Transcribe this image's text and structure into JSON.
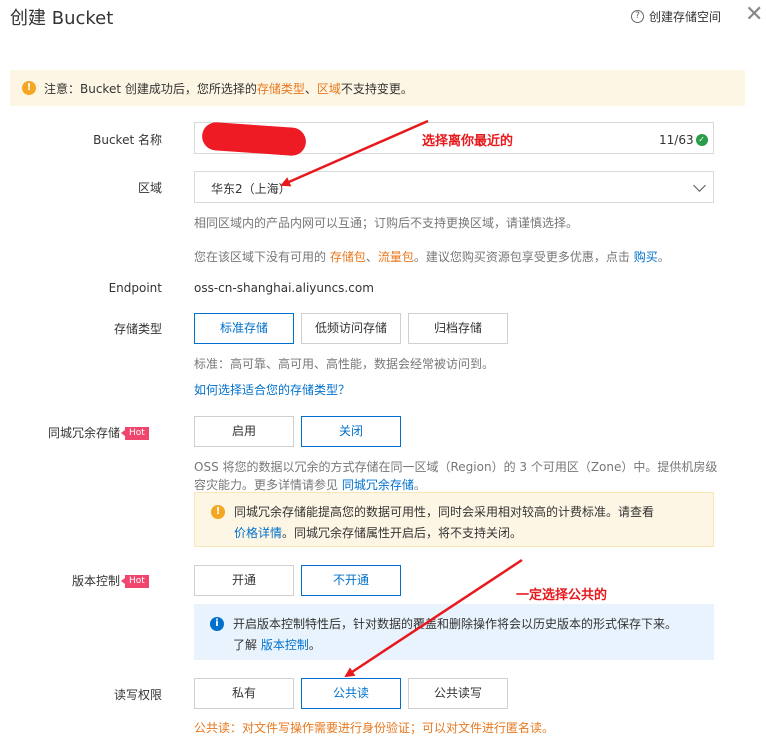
{
  "header": {
    "title": "创建 Bucket",
    "help_label": "创建存储空间",
    "help_icon": "?",
    "close": "✕"
  },
  "notice": {
    "prefix": "注意：Bucket 创建成功后，您所选择的 ",
    "hl1": "存储类型",
    "sep": "、",
    "hl2": "区域",
    "suffix": " 不支持变更。"
  },
  "bucket_name": {
    "label": "Bucket 名称",
    "count": "11/63",
    "annotation": "选择离你最近的"
  },
  "region": {
    "label": "区域",
    "value": "华东2（上海）",
    "hint1": "相同区域内的产品内网可以互通；订购后不支持更换区域，请谨慎选择。",
    "hint2_pre": "您在该区域下没有可用的 ",
    "hint2_l1": "存储包",
    "hint2_sep": "、",
    "hint2_l2": "流量包",
    "hint2_mid": "。建议您购买资源包享受更多优惠，点击 ",
    "hint2_link": "购买",
    "hint2_end": "。"
  },
  "endpoint": {
    "label": "Endpoint",
    "value": "oss-cn-shanghai.aliyuncs.com"
  },
  "storage_class": {
    "label": "存储类型",
    "options": [
      "标准存储",
      "低频访问存储",
      "归档存储"
    ],
    "hint": "标准：高可靠、高可用、高性能，数据会经常被访问到。",
    "link": "如何选择适合您的存储类型？"
  },
  "zone_redundant": {
    "label": "同城冗余存储",
    "badge": "Hot",
    "options": [
      "启用",
      "关闭"
    ],
    "desc1": "OSS 将您的数据以冗余的方式存储在同一区域（Region）的 3 个可用区（Zone）中。提供机房级",
    "desc2_pre": "容灾能力。更多详情请参见 ",
    "desc2_link": "同城冗余存储",
    "desc2_end": "。",
    "warn1": "同城冗余存储能提高您的数据可用性，同时会采用相对较高的计费标准。请查看",
    "warn2_link": "价格详情",
    "warn2_rest": "。同城冗余存储属性开启后，将不支持关闭。"
  },
  "versioning": {
    "label": "版本控制",
    "badge": "Hot",
    "options": [
      "开通",
      "不开通"
    ],
    "annotation": "一定选择公共的",
    "info1": "开启版本控制特性后，针对数据的覆盖和删除操作将会以历史版本的形式保存下来。",
    "info2_pre": "了解 ",
    "info2_link": "版本控制",
    "info2_end": "。"
  },
  "acl": {
    "label": "读写权限",
    "options": [
      "私有",
      "公共读",
      "公共读写"
    ],
    "warning": "公共读：对文件写操作需要进行身份验证；可以对文件进行匿名读。"
  },
  "colors": {
    "accent": "#0070cc",
    "orange": "#e8781e",
    "annotation": "#e8191d"
  }
}
